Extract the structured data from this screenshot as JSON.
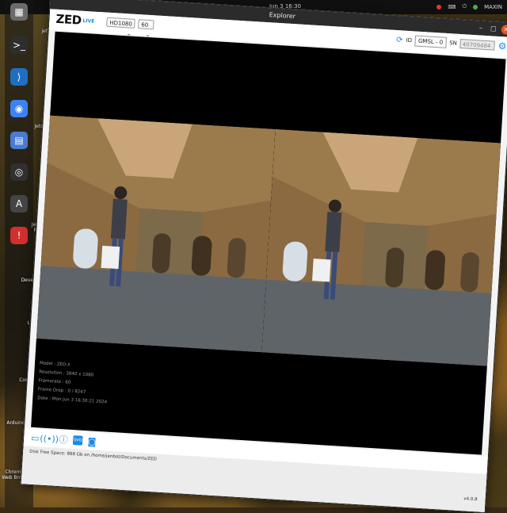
{
  "system": {
    "clock": "Jun 3  16:30",
    "user": "MAXIN"
  },
  "dock": {
    "items": [
      {
        "name": "files-icon",
        "glyph": "▦",
        "color": "#6b6b6b"
      },
      {
        "name": "terminal-icon",
        "glyph": ">_",
        "color": "#2e2e2e"
      },
      {
        "name": "vscode-icon",
        "glyph": "⟩",
        "color": "#1f6fc1"
      },
      {
        "name": "chromium-icon",
        "glyph": "◉",
        "color": "#3b82f6"
      },
      {
        "name": "notes-icon",
        "glyph": "▤",
        "color": "#4a7bd1"
      },
      {
        "name": "obs-icon",
        "glyph": "◎",
        "color": "#303030"
      },
      {
        "name": "arduino-icon",
        "glyph": "A",
        "color": "#444444"
      },
      {
        "name": "alert-icon",
        "glyph": "!",
        "color": "#d32f2f"
      }
    ]
  },
  "desktop": {
    "labels": [
      "jetbo",
      "Jetson D",
      "Jetson S Forum",
      "Developer",
      "L4T",
      "Comm",
      "Arduino IDE",
      "Chromium Web Browser"
    ]
  },
  "window": {
    "title": "Explorer",
    "logo": "ZED",
    "live": "LIVE",
    "resolution": "HD1080",
    "fps": "60",
    "id_label": "ID",
    "id_value": "GMSL - 0",
    "sn_label": "SN",
    "sn_value": "40709484",
    "info": {
      "model": "Model : ZED-X",
      "resolution": "Resolution : 3840 x 1080",
      "framerate": "Framerate : 60",
      "frame_drop": "Frame Drop : 0 / 8247",
      "date": "Date : Mon Jun 3 16:30:21 2024"
    },
    "disk": "Disk Free Space: 868 Gb  on /home/jenbot/Documents/ZED",
    "version": "v4.0.8"
  },
  "colors": {
    "accent": "#1e88e5",
    "close": "#e95420"
  }
}
